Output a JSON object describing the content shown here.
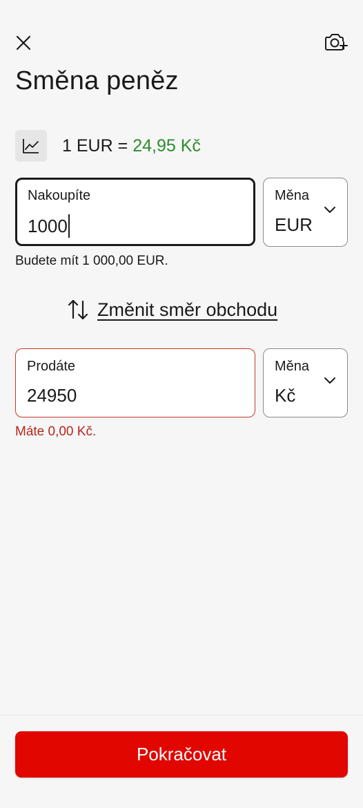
{
  "header": {
    "title": "Směna peněz",
    "close_icon": "close-icon",
    "camera_icon": "camera-plus-icon"
  },
  "rate": {
    "chart_icon": "line-chart-icon",
    "base": "1 EUR =",
    "value": "24,95 Kč",
    "value_color": "#2e8b2e"
  },
  "buy": {
    "label": "Nakoupíte",
    "value": "1000",
    "currency_label": "Měna",
    "currency_value": "EUR",
    "helper": "Budete mít 1 000,00 EUR."
  },
  "swap": {
    "icon": "swap-vertical-icon",
    "label": "Změnit směr obchodu"
  },
  "sell": {
    "label": "Prodáte",
    "value": "24950",
    "currency_label": "Měna",
    "currency_value": "Kč",
    "helper": "Máte 0,00 Kč.",
    "error_color": "#b3261e"
  },
  "footer": {
    "continue_label": "Pokračovat",
    "button_color": "#e10600"
  }
}
